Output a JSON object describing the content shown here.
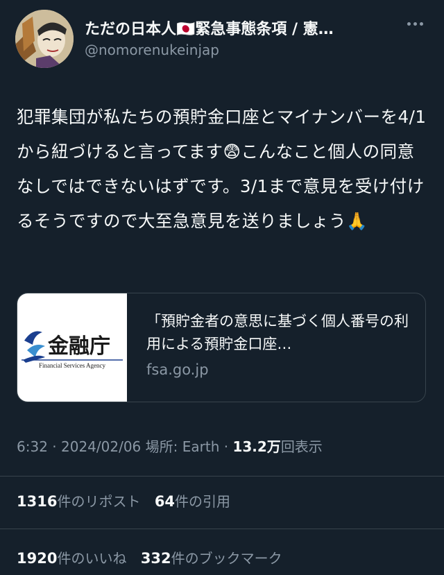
{
  "author": {
    "display_name": "ただの日本人🇯🇵緊急事態条項 / 憲…",
    "handle": "@nomorenukeinjap"
  },
  "tweet": {
    "text": "犯罪集団が私たちの預貯金口座とマイナンバーを4/1から紐づけると言ってます😨こんなこと個人の同意なしではできないはずです。3/1まで意見を受け付けるそうですので大至急意見を送りましょう🙏"
  },
  "card": {
    "logo_text": "金融庁",
    "logo_subtext": "Financial Services Agency",
    "title": "「預貯金者の意思に基づく個人番号の利用による預貯金口座…",
    "domain": "fsa.go.jp"
  },
  "meta": {
    "time": "6:32",
    "date": "2024/02/06",
    "location": "場所: Earth",
    "views_value": "13.2万",
    "views_label": "回表示"
  },
  "stats": {
    "reposts_count": "1316",
    "reposts_label": "件のリポスト",
    "quotes_count": "64",
    "quotes_label": "件の引用",
    "likes_count": "1920",
    "likes_label": "件のいいね",
    "bookmarks_count": "332",
    "bookmarks_label": "件のブックマーク"
  },
  "colors": {
    "background": "#15202b",
    "text": "#f7f9f9",
    "secondary": "#8b98a5",
    "border": "#38444d",
    "fsa_blue": "#1b3f8f"
  },
  "icons": [
    "more-icon",
    "avatar"
  ]
}
